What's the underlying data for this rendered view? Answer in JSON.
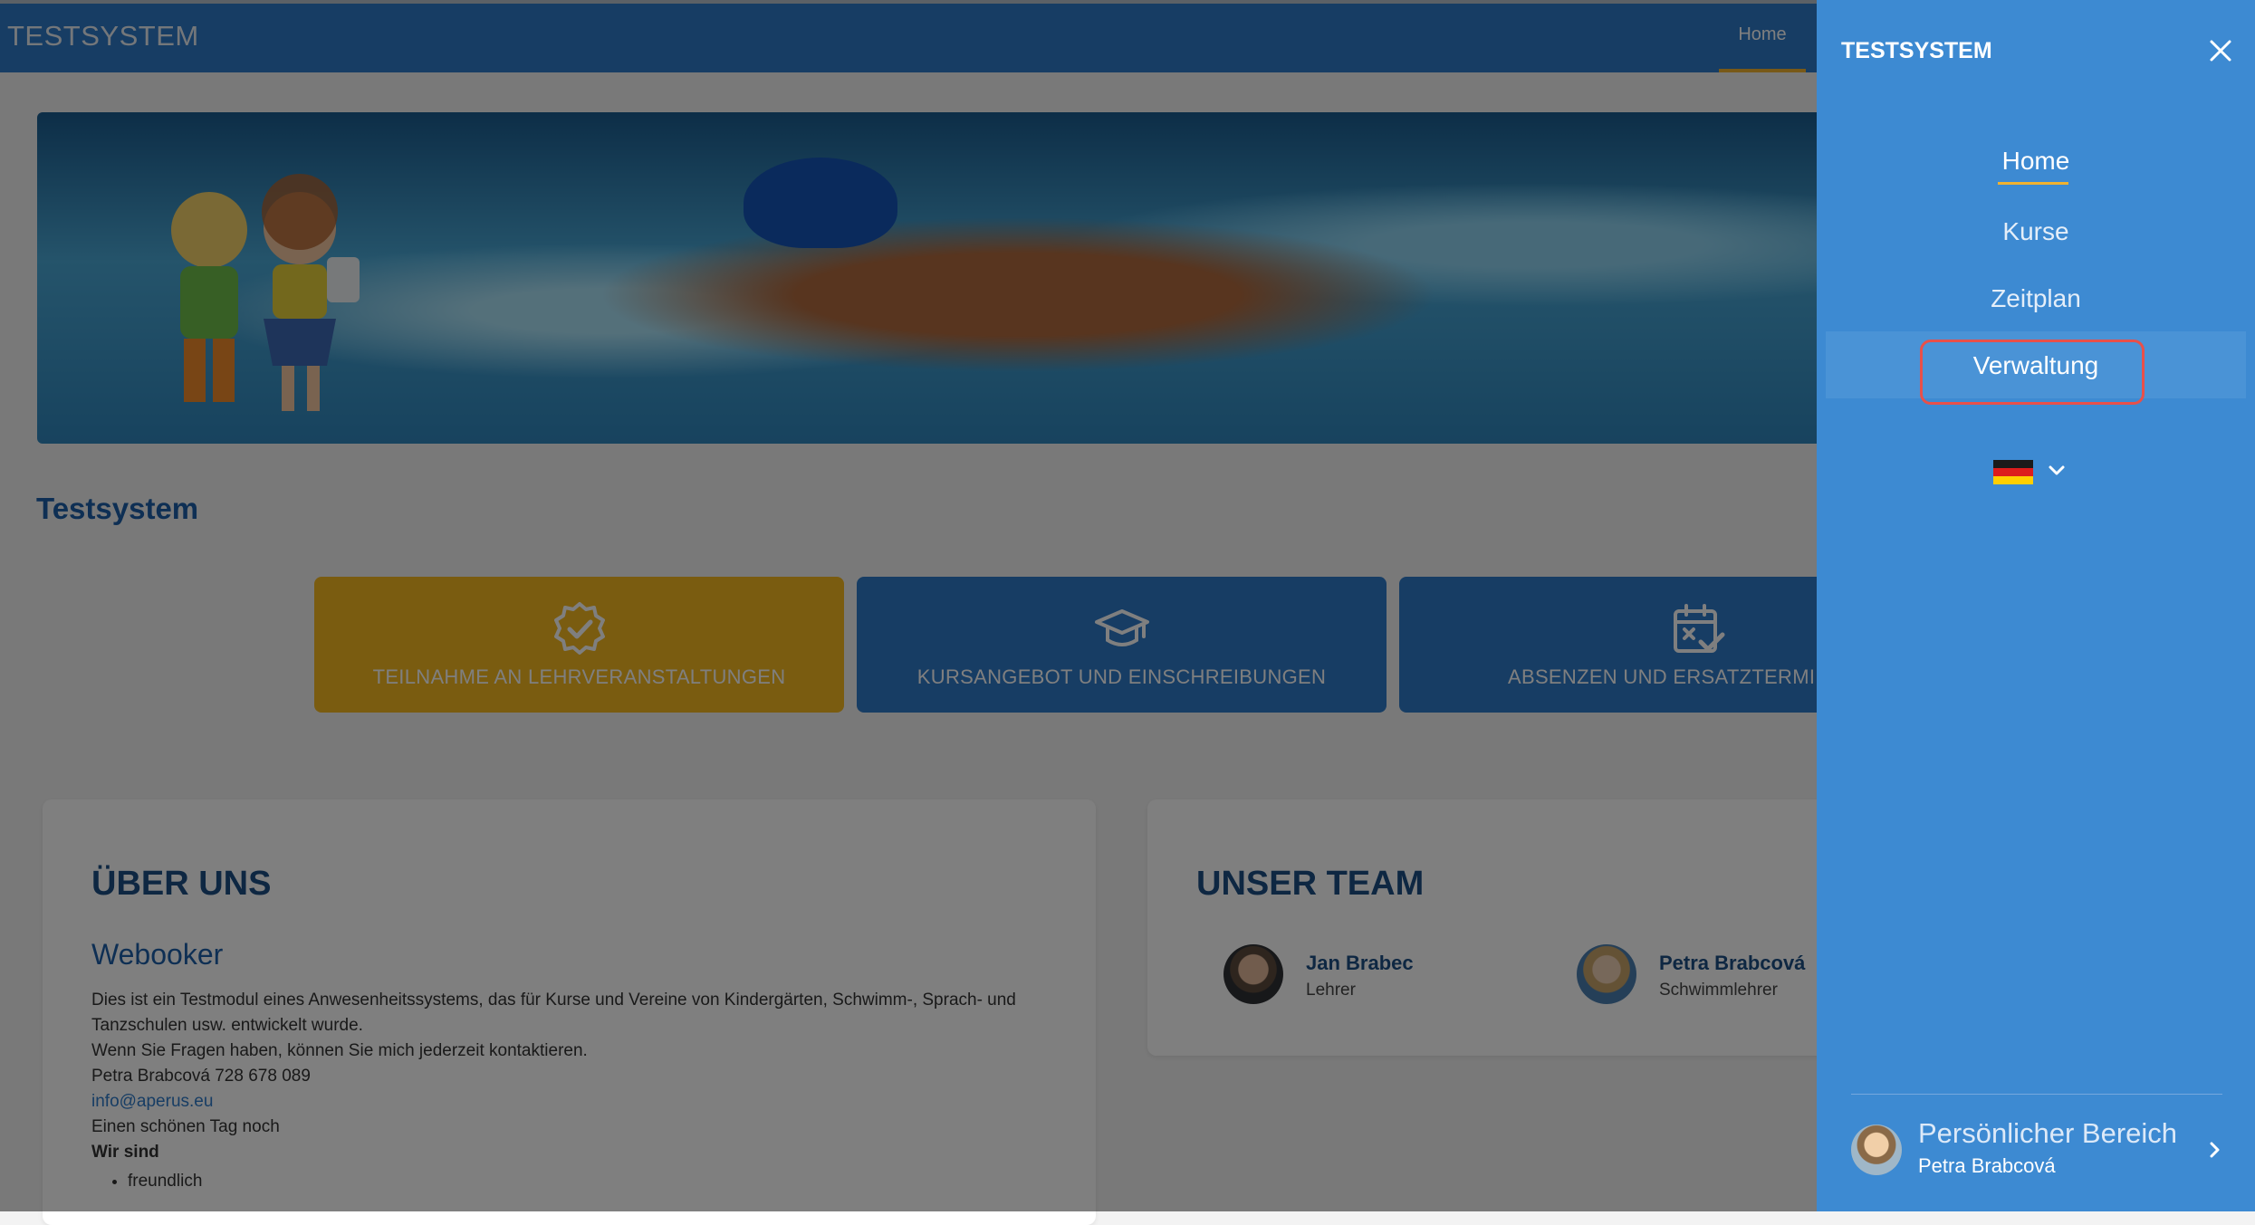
{
  "header": {
    "brand": "TESTSYSTEM",
    "nav_home": "Home"
  },
  "page": {
    "title": "Testsystem"
  },
  "tiles": [
    {
      "label": "TEILNAHME AN LEHRVERANSTALTUNGEN",
      "icon": "badge-check-icon",
      "color": "#f5b820"
    },
    {
      "label": "KURSANGEBOT UND EINSCHREIBUNGEN",
      "icon": "graduation-cap-icon",
      "color": "#2e7ac9"
    },
    {
      "label": "ABSENZEN UND ERSATZTERMINE",
      "icon": "calendar-check-icon",
      "color": "#2e7ac9"
    }
  ],
  "about": {
    "heading": "ÜBER UNS",
    "subheading": "Webooker",
    "line1": "Dies ist ein Testmodul eines Anwesenheitssystems, das für Kurse und Vereine von Kindergärten, Schwimm-, Sprach- und Tanzschulen usw. entwickelt wurde.",
    "line2": "Wenn Sie Fragen haben, können Sie mich jederzeit kontaktieren.",
    "line3": "Petra Brabcová 728 678 089",
    "email": "info@aperus.eu",
    "line4": "Einen schönen Tag noch",
    "line5": "Wir sind",
    "bullet1": "freundlich"
  },
  "team": {
    "heading": "UNSER TEAM",
    "members": [
      {
        "name": "Jan Brabec",
        "role": "Lehrer"
      },
      {
        "name": "Petra Brabcová",
        "role": "Schwimmlehrer"
      }
    ]
  },
  "drawer": {
    "brand": "TESTSYSTEM",
    "nav": [
      "Home",
      "Kurse",
      "Zeitplan",
      "Verwaltung"
    ],
    "language_flag": "german-flag-icon",
    "personal_title": "Persönlicher Bereich",
    "personal_name": "Petra Brabcová"
  },
  "colors": {
    "primary": "#2e7ac9",
    "accent": "#f5b820",
    "drawer": "#3d8ad2",
    "highlight_border": "#e8504a"
  }
}
